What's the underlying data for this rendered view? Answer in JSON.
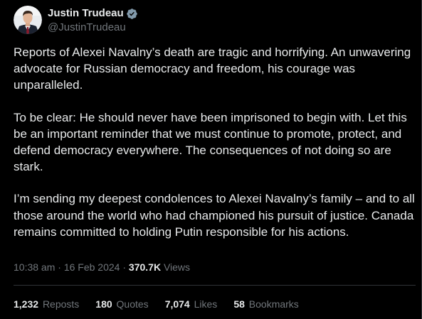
{
  "author": {
    "display_name": "Justin Trudeau",
    "handle": "@JustinTrudeau"
  },
  "tweet": {
    "paragraphs": [
      "Reports of Alexei Navalny’s death are tragic and horrifying. An unwavering advocate for Russian democracy and freedom, his courage was unparalleled.",
      "To be clear: He should never have been imprisoned to begin with. Let this be an important reminder that we must continue to promote, protect, and defend democracy everywhere. The consequences of not doing so are stark.",
      "I’m sending my deepest condolences to Alexei Navalny’s family – and to all those around the world who had championed his pursuit of justice. Canada remains committed to holding Putin responsible for his actions."
    ]
  },
  "meta": {
    "time": "10:38 am",
    "separator1": " · ",
    "date": "16 Feb 2024",
    "separator2": " · ",
    "views_count": "370.7K",
    "views_label": " Views"
  },
  "stats": {
    "reposts_count": "1,232",
    "reposts_label": "Reposts",
    "quotes_count": "180",
    "quotes_label": "Quotes",
    "likes_count": "7,074",
    "likes_label": "Likes",
    "bookmarks_count": "58",
    "bookmarks_label": "Bookmarks"
  },
  "colors": {
    "background": "#000000",
    "text_primary": "#e7e9ea",
    "text_secondary": "#71767b",
    "verified_badge": "#829aab",
    "divider": "#2f3336"
  },
  "icons": {
    "verified": "verified-badge-icon"
  }
}
